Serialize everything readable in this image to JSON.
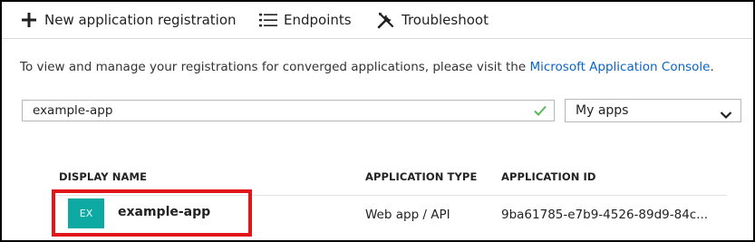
{
  "toolbar": {
    "new_registration": {
      "label": "New application registration",
      "icon": "plus-icon"
    },
    "endpoints": {
      "label": "Endpoints",
      "icon": "list-icon"
    },
    "troubleshoot": {
      "label": "Troubleshoot",
      "icon": "wrench-icon"
    }
  },
  "info": {
    "text": "To view and manage your registrations for converged applications, please visit the ",
    "link": "Microsoft Application Console",
    "suffix": "."
  },
  "search": {
    "value": "example-app",
    "status_icon": "checkmark-icon",
    "status_color": "#5cb85c"
  },
  "filter": {
    "selected": "My apps",
    "icon": "chevron-down-icon"
  },
  "table": {
    "columns": [
      "DISPLAY NAME",
      "APPLICATION TYPE",
      "APPLICATION ID"
    ],
    "rows": [
      {
        "badge": "EX",
        "badge_color": "#0fa9a4",
        "name": "example-app",
        "type": "Web app / API",
        "app_id": "9ba61785-e7b9-4526-89d9-84c..."
      }
    ]
  },
  "highlight_color": "#e0161b"
}
